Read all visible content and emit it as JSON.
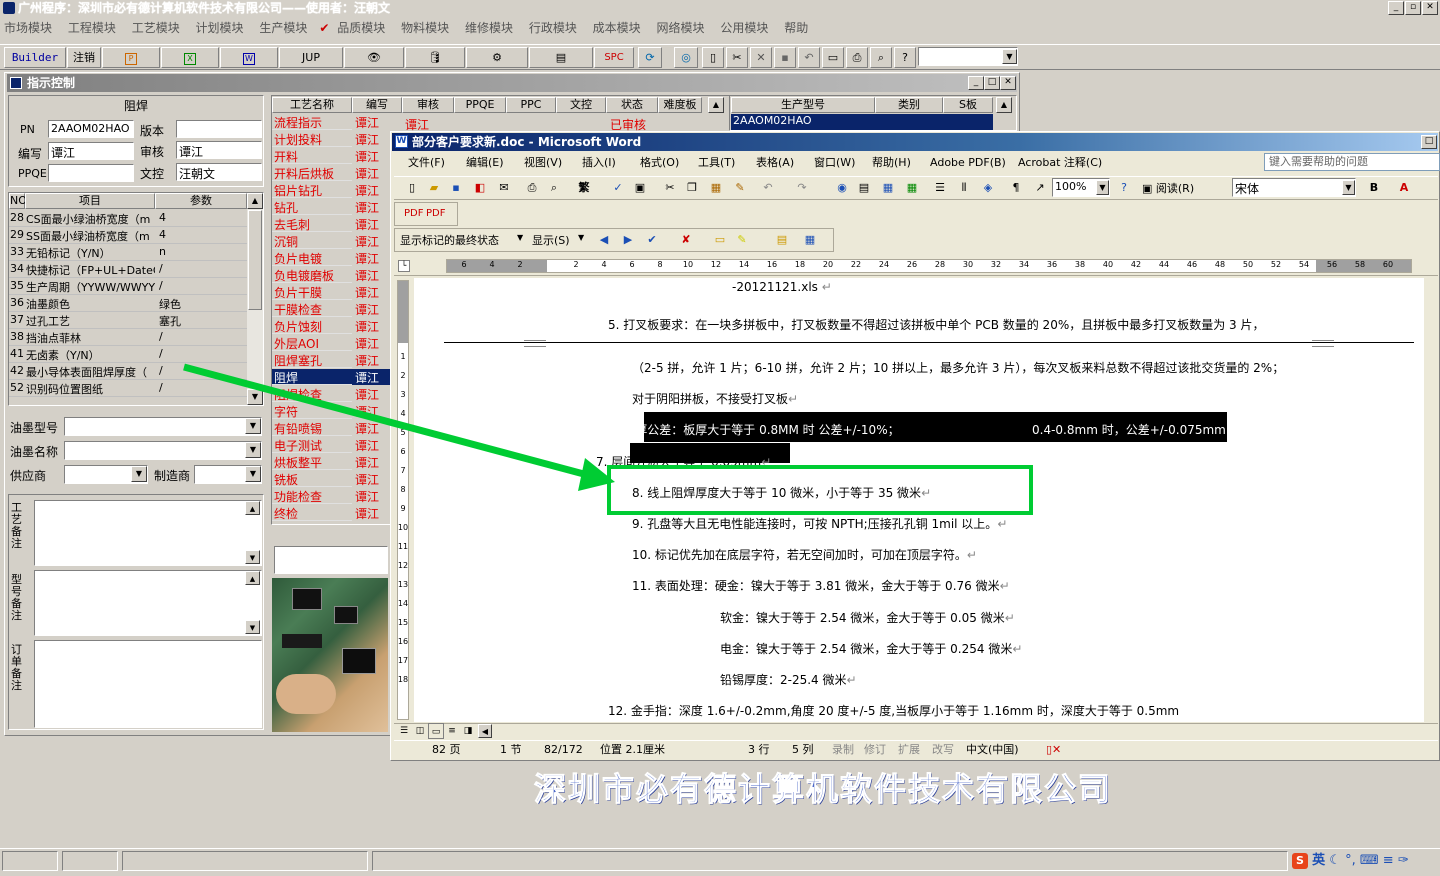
{
  "app_title": "广州程序：深圳市必有德计算机软件技术有限公司——使用者：汪朝文",
  "main_menu": [
    "市场模块",
    "工程模块",
    "工艺模块",
    "计划模块",
    "生产模块",
    "品质模块",
    "物料模块",
    "维修模块",
    "行政模块",
    "成本模块",
    "网络模块",
    "公用模块",
    "帮助"
  ],
  "toolbar": {
    "builder": "Builder",
    "logout": "注销",
    "jup": "JUP",
    "spc": "SPC"
  },
  "child_window": {
    "title": "指示控制"
  },
  "form": {
    "section_title": "阻焊",
    "pn_label": "PN",
    "pn_value": "2AAOM02HAO",
    "version_label": "版本",
    "version_value": "",
    "editor_label": "编写",
    "editor_value": "谭江",
    "reviewer_label": "审核",
    "reviewer_value": "谭江",
    "ppqe_label": "PPQE",
    "ppqe_value": "",
    "doc_label": "文控",
    "doc_value": "汪朝文"
  },
  "params_table": {
    "headers": [
      "NO",
      "项目",
      "参数"
    ],
    "rows": [
      [
        "28",
        "CS面最小绿油桥宽度（m",
        "4"
      ],
      [
        "29",
        "SS面最小绿油桥宽度（m",
        "4"
      ],
      [
        "33",
        "无铅标记（Y/N）",
        "n"
      ],
      [
        "34",
        "快捷标记（FP+UL+DateCo",
        "/"
      ],
      [
        "35",
        "生产周期（YYWW/WWYY）",
        "/"
      ],
      [
        "36",
        "油墨颜色",
        "绿色"
      ],
      [
        "37",
        "过孔工艺",
        "塞孔"
      ],
      [
        "38",
        "挡油点菲林",
        "/"
      ],
      [
        "41",
        "无卤素（Y/N）",
        "/"
      ],
      [
        "42",
        "最小导体表面阻焊厚度（",
        "/"
      ],
      [
        "52",
        "识别码位置图纸",
        "/"
      ]
    ]
  },
  "ink": {
    "model_label": "油墨型号",
    "name_label": "油墨名称",
    "supplier_label": "供应商",
    "maker_label": "制造商"
  },
  "notes": {
    "process": "工艺备注",
    "model": "型号备注",
    "order": "订单备注"
  },
  "process_table": {
    "headers": [
      "工艺名称",
      "编写",
      "审核",
      "PPQE",
      "PPC",
      "文控",
      "状态",
      "难度板"
    ],
    "first_row": {
      "reviewer": "谭江",
      "status": "已审核"
    },
    "rows": [
      {
        "name": "流程指示",
        "editor": "谭江"
      },
      {
        "name": "计划投料",
        "editor": "谭江"
      },
      {
        "name": "开料",
        "editor": "谭江"
      },
      {
        "name": "开料后烘板",
        "editor": "谭江"
      },
      {
        "name": "铝片钻孔",
        "editor": "谭江"
      },
      {
        "name": "钻孔",
        "editor": "谭江"
      },
      {
        "name": "去毛刺",
        "editor": "谭江"
      },
      {
        "name": "沉铜",
        "editor": "谭江"
      },
      {
        "name": "负片电镀",
        "editor": "谭江"
      },
      {
        "name": "负电镀磨板",
        "editor": "谭江"
      },
      {
        "name": "负片干膜",
        "editor": "谭江"
      },
      {
        "name": "干膜检查",
        "editor": "谭江"
      },
      {
        "name": "负片蚀刻",
        "editor": "谭江"
      },
      {
        "name": "外层AOI",
        "editor": "谭江"
      },
      {
        "name": "阻焊塞孔",
        "editor": "谭江"
      },
      {
        "name": "阻焊",
        "editor": "谭江"
      },
      {
        "name": "阻焊检查",
        "editor": "谭江"
      },
      {
        "name": "字符",
        "editor": "谭江"
      },
      {
        "name": "有铅喷锡",
        "editor": "谭江"
      },
      {
        "name": "电子测试",
        "editor": "谭江"
      },
      {
        "name": "烘板整平",
        "editor": "谭江"
      },
      {
        "name": "铣板",
        "editor": "谭江"
      },
      {
        "name": "功能检查",
        "editor": "谭江"
      },
      {
        "name": "终检",
        "editor": "谭江"
      }
    ]
  },
  "model_table": {
    "headers": [
      "生产型号",
      "类别",
      "S板"
    ],
    "rows": [
      [
        "2AAOM02HAO",
        "",
        ""
      ]
    ]
  },
  "word": {
    "title": "部分客户要求新.doc - Microsoft Word",
    "menu": [
      "文件(F)",
      "编辑(E)",
      "视图(V)",
      "插入(I)",
      "格式(O)",
      "工具(T)",
      "表格(A)",
      "窗口(W)",
      "帮助(H)",
      "Adobe PDF(B)",
      "Acrobat 注释(C)"
    ],
    "help_placeholder": "键入需要帮助的问题",
    "zoom": "100%",
    "read_label": "阅读(R)",
    "font": "宋体",
    "show_markup": "显示标记的最终状态",
    "show_label": "显示(S)",
    "ruler_ticks": [
      "6",
      "4",
      "2",
      "",
      "2",
      "4",
      "6",
      "8",
      "10",
      "12",
      "14",
      "16",
      "18",
      "20",
      "22",
      "24",
      "26",
      "28",
      "30",
      "32",
      "34",
      "36",
      "38",
      "40",
      "42",
      "44",
      "46",
      "48",
      "50",
      "52",
      "54",
      "56",
      "58",
      "60"
    ],
    "vruler_ticks": [
      "1",
      "2",
      "3",
      "4",
      "5",
      "6",
      "7",
      "8",
      "9",
      "10",
      "11",
      "12",
      "13",
      "14",
      "15",
      "16",
      "17",
      "18"
    ],
    "lines": {
      "l0": "-20121121.xls",
      "l1": "5.  打叉板要求：在一块多拼板中，打叉板数量不得超过该拼板中单个 PCB 数量的 20%，且拼板中最多打叉板数量为 3 片，",
      "l2": "（2-5 拼，允许 1 片；6-10 拼，允许 2 片；10 拼以上，最多允许 3 片），每次叉板来料总数不得超过该批交货量的 2%；",
      "l3": "对于阴阳拼板，不接受打叉板",
      "l4a": "6.  板厚公差：板厚大于等于 0.8MM 时   公差+/-10%；",
      "l4b": "0.4-0.8mm 时，公差+/-0.075mm",
      "l5": "7.  层间介质大于等于 0.09mm",
      "l6": "8.  线上阻焊厚度大于等于 10 微米，小于等于 35 微米",
      "l7": "9.  孔盘等大且无电性能连接时，可按 NPTH;压接孔孔铜 1mil 以上。",
      "l8": "10. 标记优先加在底层字符，若无空间加时，可加在顶层字符。",
      "l9": "11. 表面处理：硬金：镍大于等于 3.81 微米，金大于等于 0.76 微米",
      "l10": "软金：镍大于等于 2.54 微米，金大于等于 0.05 微米",
      "l11": "电金：镍大于等于 2.54 微米，金大于等于 0.254 微米",
      "l12": "铅锡厚度：2-25.4 微米",
      "l13": "12. 金手指：深度 1.6+/-0.2mm,角度 20 度+/-5 度,当板厚小于等于 1.16mm 时，深度大于等于 0.5mm"
    },
    "status": {
      "page": "82 页",
      "section": "1 节",
      "pages": "82/172",
      "position": "位置 2.1厘米",
      "line": "3 行",
      "col": "5 列",
      "rec": "录制",
      "trk": "修订",
      "ext": "扩展",
      "ovr": "改写",
      "lang": "中文(中国)"
    }
  },
  "company_banner": "深圳市必有德计算机软件技术有限公司",
  "tray": {
    "ime": "英"
  },
  "colors": {
    "highlight": "#00cc33",
    "title_blue": "#0a246a",
    "red_text": "#e00000",
    "selection": "#0a246a"
  }
}
